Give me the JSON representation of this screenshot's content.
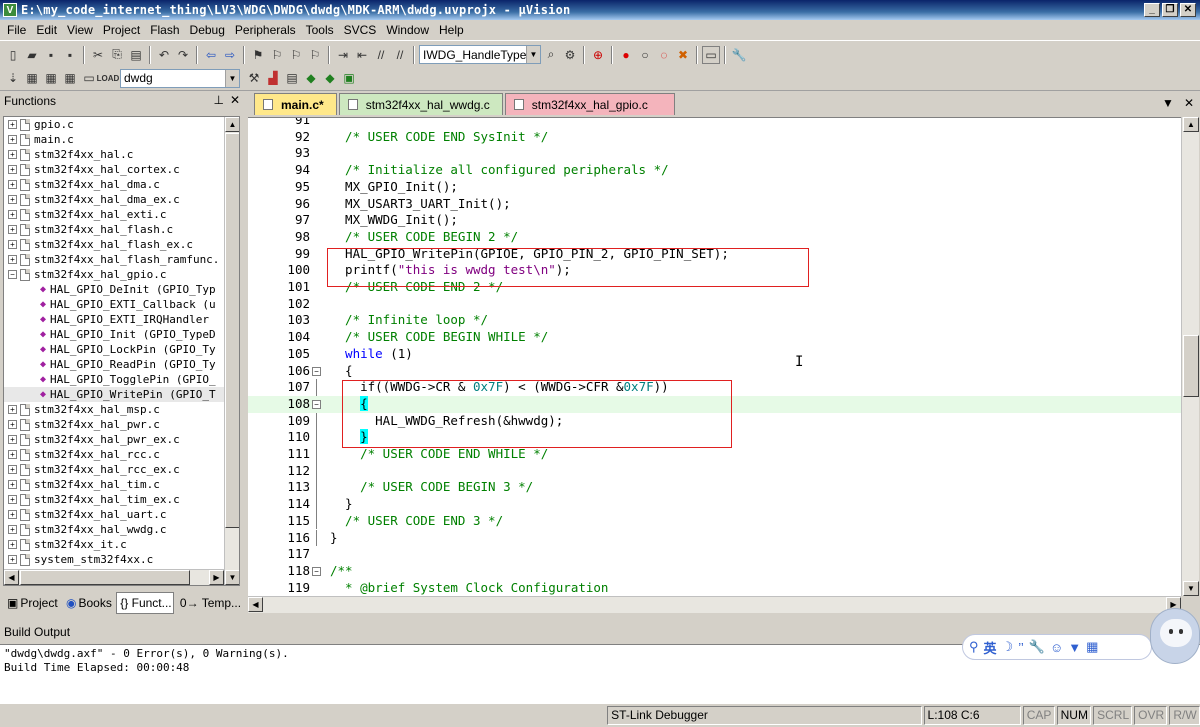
{
  "window": {
    "title": "E:\\my_code_internet_thing\\LV3\\WDG\\DWDG\\dwdg\\MDK-ARM\\dwdg.uvprojx - µVision",
    "app_icon": "V"
  },
  "menu": [
    "File",
    "Edit",
    "View",
    "Project",
    "Flash",
    "Debug",
    "Peripherals",
    "Tools",
    "SVCS",
    "Window",
    "Help"
  ],
  "toolbar1": {
    "find_combo": "IWDG_HandleTypeD"
  },
  "toolbar2": {
    "target_combo": "dwdg"
  },
  "functions_panel": {
    "title": "Functions",
    "tree": [
      {
        "kind": "file",
        "label": "gpio.c"
      },
      {
        "kind": "file",
        "label": "main.c"
      },
      {
        "kind": "file",
        "label": "stm32f4xx_hal.c"
      },
      {
        "kind": "file",
        "label": "stm32f4xx_hal_cortex.c"
      },
      {
        "kind": "file",
        "label": "stm32f4xx_hal_dma.c"
      },
      {
        "kind": "file",
        "label": "stm32f4xx_hal_dma_ex.c"
      },
      {
        "kind": "file",
        "label": "stm32f4xx_hal_exti.c"
      },
      {
        "kind": "file",
        "label": "stm32f4xx_hal_flash.c"
      },
      {
        "kind": "file",
        "label": "stm32f4xx_hal_flash_ex.c"
      },
      {
        "kind": "file",
        "label": "stm32f4xx_hal_flash_ramfunc."
      },
      {
        "kind": "file",
        "label": "stm32f4xx_hal_gpio.c",
        "expanded": true
      },
      {
        "kind": "fn",
        "label": "HAL_GPIO_DeInit (GPIO_Typ"
      },
      {
        "kind": "fn",
        "label": "HAL_GPIO_EXTI_Callback (u"
      },
      {
        "kind": "fn",
        "label": "HAL_GPIO_EXTI_IRQHandler"
      },
      {
        "kind": "fn",
        "label": "HAL_GPIO_Init (GPIO_TypeD"
      },
      {
        "kind": "fn",
        "label": "HAL_GPIO_LockPin (GPIO_Ty"
      },
      {
        "kind": "fn",
        "label": "HAL_GPIO_ReadPin (GPIO_Ty"
      },
      {
        "kind": "fn",
        "label": "HAL_GPIO_TogglePin (GPIO_"
      },
      {
        "kind": "fn",
        "label": "HAL_GPIO_WritePin (GPIO_T",
        "selected": true
      },
      {
        "kind": "file",
        "label": "stm32f4xx_hal_msp.c"
      },
      {
        "kind": "file",
        "label": "stm32f4xx_hal_pwr.c"
      },
      {
        "kind": "file",
        "label": "stm32f4xx_hal_pwr_ex.c"
      },
      {
        "kind": "file",
        "label": "stm32f4xx_hal_rcc.c"
      },
      {
        "kind": "file",
        "label": "stm32f4xx_hal_rcc_ex.c"
      },
      {
        "kind": "file",
        "label": "stm32f4xx_hal_tim.c"
      },
      {
        "kind": "file",
        "label": "stm32f4xx_hal_tim_ex.c"
      },
      {
        "kind": "file",
        "label": "stm32f4xx_hal_uart.c"
      },
      {
        "kind": "file",
        "label": "stm32f4xx_hal_wwdg.c"
      },
      {
        "kind": "file",
        "label": "stm32f4xx_it.c"
      },
      {
        "kind": "file",
        "label": "system_stm32f4xx.c"
      }
    ],
    "tabs": [
      "Project",
      "Books",
      "{} Funct...",
      "0→ Temp..."
    ]
  },
  "editor": {
    "tabs": [
      "main.c*",
      "stm32f4xx_hal_wwdg.c",
      "stm32f4xx_hal_gpio.c"
    ],
    "current_line": 108,
    "lines": [
      {
        "n": "91",
        "segs": []
      },
      {
        "n": "92",
        "segs": [
          [
            "c-com",
            "  /* USER CODE END SysInit */"
          ]
        ]
      },
      {
        "n": "93",
        "segs": []
      },
      {
        "n": "94",
        "segs": [
          [
            "c-com",
            "  /* Initialize all configured peripherals */"
          ]
        ]
      },
      {
        "n": "95",
        "segs": [
          [
            "c-def",
            "  MX_GPIO_Init();"
          ]
        ]
      },
      {
        "n": "96",
        "segs": [
          [
            "c-def",
            "  MX_USART3_UART_Init();"
          ]
        ]
      },
      {
        "n": "97",
        "segs": [
          [
            "c-def",
            "  MX_WWDG_Init();"
          ]
        ]
      },
      {
        "n": "98",
        "segs": [
          [
            "c-com",
            "  /* USER CODE BEGIN 2 */"
          ]
        ]
      },
      {
        "n": "99",
        "segs": [
          [
            "c-def",
            "  HAL_GPIO_WritePin(GPIOE, GPIO_PIN_2, GPIO_PIN_SET);"
          ]
        ]
      },
      {
        "n": "100",
        "segs": [
          [
            "c-def",
            "  printf("
          ],
          [
            "c-str",
            "\"this is wwdg test\\n\""
          ],
          [
            "c-def",
            ");"
          ]
        ]
      },
      {
        "n": "101",
        "segs": [
          [
            "c-com",
            "  /* USER CODE END 2 */"
          ]
        ]
      },
      {
        "n": "102",
        "segs": []
      },
      {
        "n": "103",
        "segs": [
          [
            "c-com",
            "  /* Infinite loop */"
          ]
        ]
      },
      {
        "n": "104",
        "segs": [
          [
            "c-com",
            "  /* USER CODE BEGIN WHILE */"
          ]
        ]
      },
      {
        "n": "105",
        "segs": [
          [
            "c-kw",
            "  while"
          ],
          [
            "c-def",
            " (1)"
          ]
        ]
      },
      {
        "n": "106",
        "fold": "-",
        "segs": [
          [
            "c-def",
            "  {"
          ]
        ]
      },
      {
        "n": "107",
        "segs": [
          [
            "c-def",
            "    if((WWDG->CR & "
          ],
          [
            "c-num",
            "0x7F"
          ],
          [
            "c-def",
            ") < (WWDG->CFR &"
          ],
          [
            "c-num",
            "0x7F"
          ],
          [
            "c-def",
            "))"
          ]
        ]
      },
      {
        "n": "108",
        "fold": "-",
        "segs": [
          [
            "c-def",
            "    "
          ],
          [
            "bracehl",
            "{"
          ]
        ]
      },
      {
        "n": "109",
        "segs": [
          [
            "c-def",
            "      HAL_WWDG_Refresh(&hwwdg);"
          ]
        ]
      },
      {
        "n": "110",
        "segs": [
          [
            "c-def",
            "    "
          ],
          [
            "bracehl",
            "}"
          ]
        ]
      },
      {
        "n": "111",
        "segs": [
          [
            "c-com",
            "    /* USER CODE END WHILE */"
          ]
        ]
      },
      {
        "n": "112",
        "segs": []
      },
      {
        "n": "113",
        "segs": [
          [
            "c-com",
            "    /* USER CODE BEGIN 3 */"
          ]
        ]
      },
      {
        "n": "114",
        "segs": [
          [
            "c-def",
            "  }"
          ]
        ]
      },
      {
        "n": "115",
        "segs": [
          [
            "c-com",
            "  /* USER CODE END 3 */"
          ]
        ]
      },
      {
        "n": "116",
        "segs": [
          [
            "c-def",
            "}"
          ]
        ]
      },
      {
        "n": "117",
        "segs": []
      },
      {
        "n": "118",
        "fold": "-",
        "segs": [
          [
            "c-com",
            "/**"
          ]
        ]
      },
      {
        "n": "119",
        "segs": [
          [
            "c-com",
            "  * @brief System Clock Configuration"
          ]
        ]
      }
    ]
  },
  "build_output": {
    "label": "Build Output",
    "lines": [
      "\"dwdg\\dwdg.axf\" - 0 Error(s), 0 Warning(s).",
      "Build Time Elapsed:  00:00:48"
    ]
  },
  "status": {
    "debugger": "ST-Link Debugger",
    "position": "L:108 C:6",
    "indicators": [
      "CAP",
      "NUM",
      "SCRL",
      "OVR",
      "R/W"
    ]
  },
  "ime": {
    "lang": "英",
    "icons": [
      "person-icon",
      "moon-icon",
      "quote-icon",
      "wrench-icon",
      "smile-icon",
      "shirt-icon",
      "grid-icon"
    ]
  },
  "colors": {
    "comment": "#008000",
    "keyword": "#0000ff",
    "string": "#800080",
    "number": "#008080",
    "highlight_box": "#e02020",
    "current_line": "#e6fae6"
  }
}
